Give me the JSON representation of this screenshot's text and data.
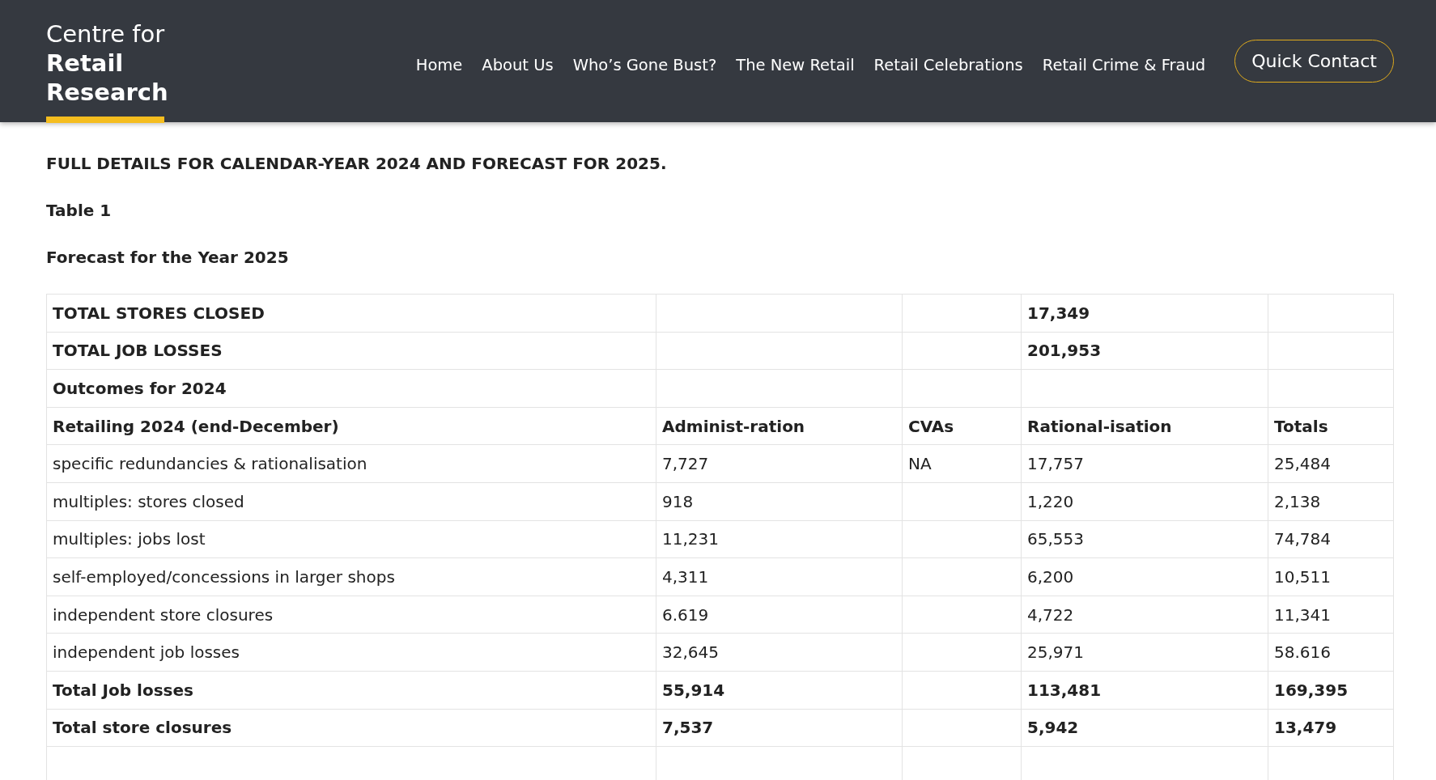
{
  "header": {
    "logo": {
      "line_1": "Centre for",
      "line_2": "Retail",
      "line_3": "Research"
    },
    "nav": [
      "Home",
      "About Us",
      "Who’s Gone Bust?",
      "The New Retail",
      "Retail Celebrations",
      "Retail Crime & Fraud"
    ],
    "button": "Quick Contact"
  },
  "content": {
    "headings": [
      "FULL DETAILS FOR CALENDAR-YEAR 2024 AND FORECAST FOR 2025.",
      "Table 1",
      "Forecast for the Year 2025"
    ],
    "table": {
      "rows": [
        {
          "bold": true,
          "cells": [
            "TOTAL STORES CLOSED",
            null,
            null,
            "17,349",
            null
          ]
        },
        {
          "bold": true,
          "cells": [
            "TOTAL JOB LOSSES",
            null,
            null,
            "201,953",
            null
          ]
        },
        {
          "bold": true,
          "cells": [
            "Outcomes for 2024",
            null,
            null,
            null,
            null
          ]
        },
        {
          "bold": true,
          "cells": [
            "Retailing 2024 (end-December)",
            "Administ-ration",
            "CVAs",
            "Rational-isation",
            "Totals"
          ]
        },
        {
          "bold": false,
          "cells": [
            "specific redundancies & rationalisation",
            "7,727",
            "NA",
            "17,757",
            "25,484"
          ]
        },
        {
          "bold": false,
          "cells": [
            "multiples: stores closed",
            "918",
            null,
            "1,220",
            "2,138"
          ]
        },
        {
          "bold": false,
          "cells": [
            "multiples: jobs lost",
            "11,231",
            null,
            "65,553",
            "74,784"
          ]
        },
        {
          "bold": false,
          "cells": [
            "self-employed/concessions in larger shops",
            "4,311",
            null,
            "6,200",
            "10,511"
          ]
        },
        {
          "bold": false,
          "cells": [
            "independent store closures",
            "6.619",
            null,
            "4,722",
            "11,341"
          ]
        },
        {
          "bold": false,
          "cells": [
            "independent job losses",
            "32,645",
            null,
            "25,971",
            "58.616"
          ]
        },
        {
          "bold": true,
          "cells": [
            "Total Job losses",
            "55,914",
            null,
            "113,481",
            "169,395"
          ]
        },
        {
          "bold": true,
          "cells": [
            "Total store closures",
            "7,537",
            null,
            "5,942",
            "13,479"
          ]
        },
        {
          "cells": [
            null,
            null,
            null,
            null,
            null
          ]
        }
      ]
    }
  }
}
